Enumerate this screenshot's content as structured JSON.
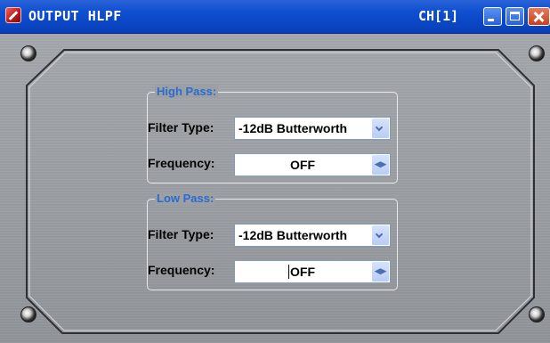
{
  "window": {
    "title": "OUTPUT HLPF",
    "channel": "CH[1]"
  },
  "high_pass": {
    "title": "High Pass:",
    "filter_type_label": "Filter Type:",
    "filter_type_value": "-12dB Butterworth",
    "frequency_label": "Frequency:",
    "frequency_value": "OFF"
  },
  "low_pass": {
    "title": "Low Pass:",
    "filter_type_label": "Filter Type:",
    "filter_type_value": "-12dB Butterworth",
    "frequency_label": "Frequency:",
    "frequency_value": "OFF"
  },
  "icons": {
    "app": "app-icon",
    "minimize": "minimize-icon",
    "maximize": "maximize-icon",
    "close": "close-icon",
    "dropdown": "chevron-down-icon",
    "spinner": "left-right-arrows-icon"
  },
  "colors": {
    "title_bar": "#0a46c6",
    "group_title": "#2a6bd0",
    "close_button": "#c6401f"
  }
}
